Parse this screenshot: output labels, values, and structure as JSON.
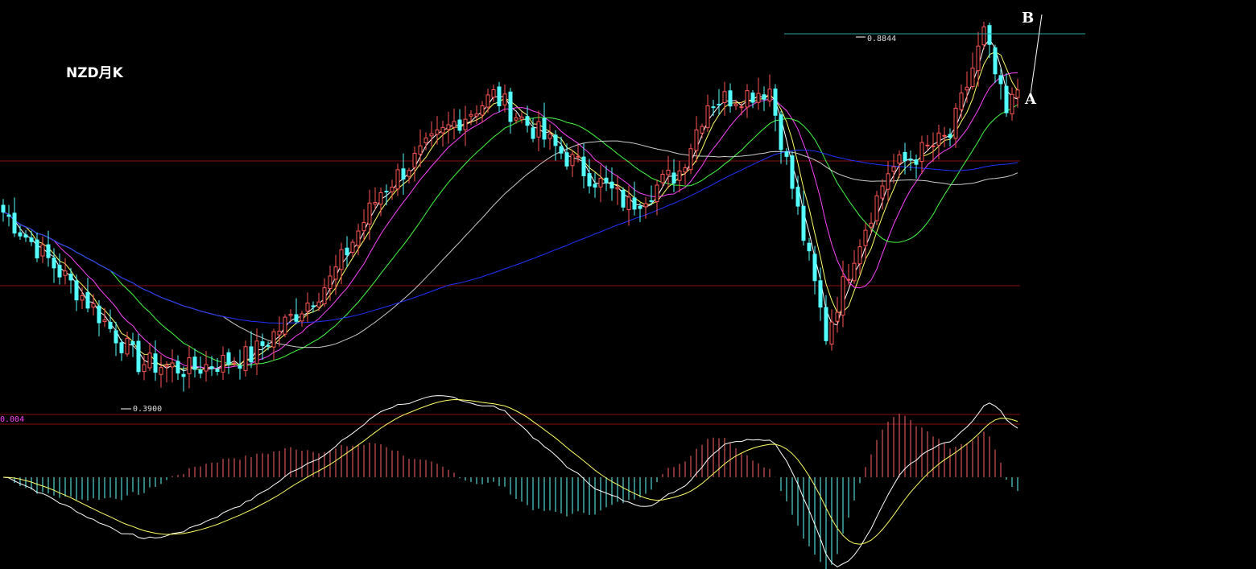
{
  "chart_data": {
    "type": "candlestick",
    "title": "NZD月K",
    "annotations": {
      "high_label": "0.8844",
      "low_label": "0.3900",
      "point_b": "B",
      "point_a": "A"
    },
    "macd_scale_label": "0.004",
    "price_range": [
      0.33,
      0.9
    ],
    "up_color": "#ff5555",
    "down_color": "#54ffff",
    "ma_colors": [
      "#ffffff",
      "#ffff66",
      "#ff44ff",
      "#44ff44",
      "#cccccc",
      "#1e32ff"
    ],
    "macd_colors": {
      "dif": "#ffffff",
      "dea": "#ffff66",
      "hist_pos": "#ff6666",
      "hist_neg": "#66ffff"
    },
    "anchors": {
      "index": [
        0,
        16,
        24,
        33,
        44,
        58,
        67,
        80,
        87,
        100,
        111,
        120,
        125,
        136,
        146,
        151,
        157,
        168,
        174,
        178,
        180
      ],
      "close": [
        0.62,
        0.48,
        0.4,
        0.39,
        0.41,
        0.52,
        0.65,
        0.75,
        0.79,
        0.7,
        0.63,
        0.68,
        0.78,
        0.8,
        0.44,
        0.56,
        0.68,
        0.73,
        0.88,
        0.76,
        0.8
      ]
    }
  }
}
